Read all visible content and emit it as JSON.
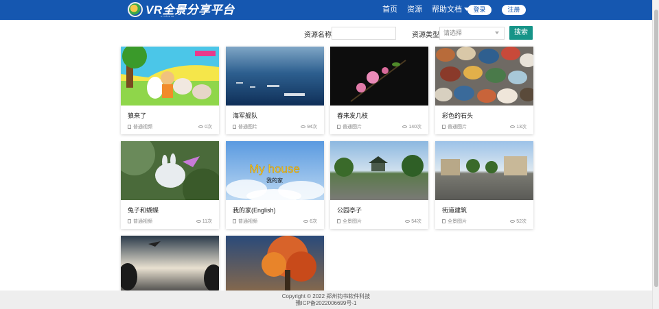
{
  "header": {
    "logo_text": "VR全景分享平台",
    "logo_subtext": "vrshare",
    "nav": {
      "home": "首页",
      "resources": "资源",
      "help": "帮助文档"
    },
    "login_label": "登录",
    "register_label": "注册"
  },
  "filters": {
    "name_label": "资源名称",
    "name_value": "",
    "type_label": "资源类型",
    "type_placeholder": "请选择",
    "search_label": "搜索"
  },
  "cards": [
    {
      "title": "狼来了",
      "type": "普通视频",
      "views": "0次"
    },
    {
      "title": "海军舰队",
      "type": "普通图片",
      "views": "94次"
    },
    {
      "title": "春来发几枝",
      "type": "普通图片",
      "views": "140次"
    },
    {
      "title": "彩色的石头",
      "type": "普通图片",
      "views": "13次"
    },
    {
      "title": "兔子和蝴蝶",
      "type": "普通视频",
      "views": "11次"
    },
    {
      "title": "我的家(English)",
      "type": "普通视频",
      "views": "6次",
      "thumb_caption": "My house",
      "thumb_subcaption": "我的家"
    },
    {
      "title": "公园亭子",
      "type": "全景图片",
      "views": "54次"
    },
    {
      "title": "街道建筑",
      "type": "全景图片",
      "views": "52次"
    },
    {
      "title": "",
      "type": "",
      "views": ""
    },
    {
      "title": "",
      "type": "",
      "views": ""
    }
  ],
  "footer": {
    "copyright": "Copyright © 2022 郑州钧书软件科技",
    "icp": "豫ICP备2022006699号-1"
  },
  "colors": {
    "header": "#1557b0",
    "accent": "#169488"
  }
}
